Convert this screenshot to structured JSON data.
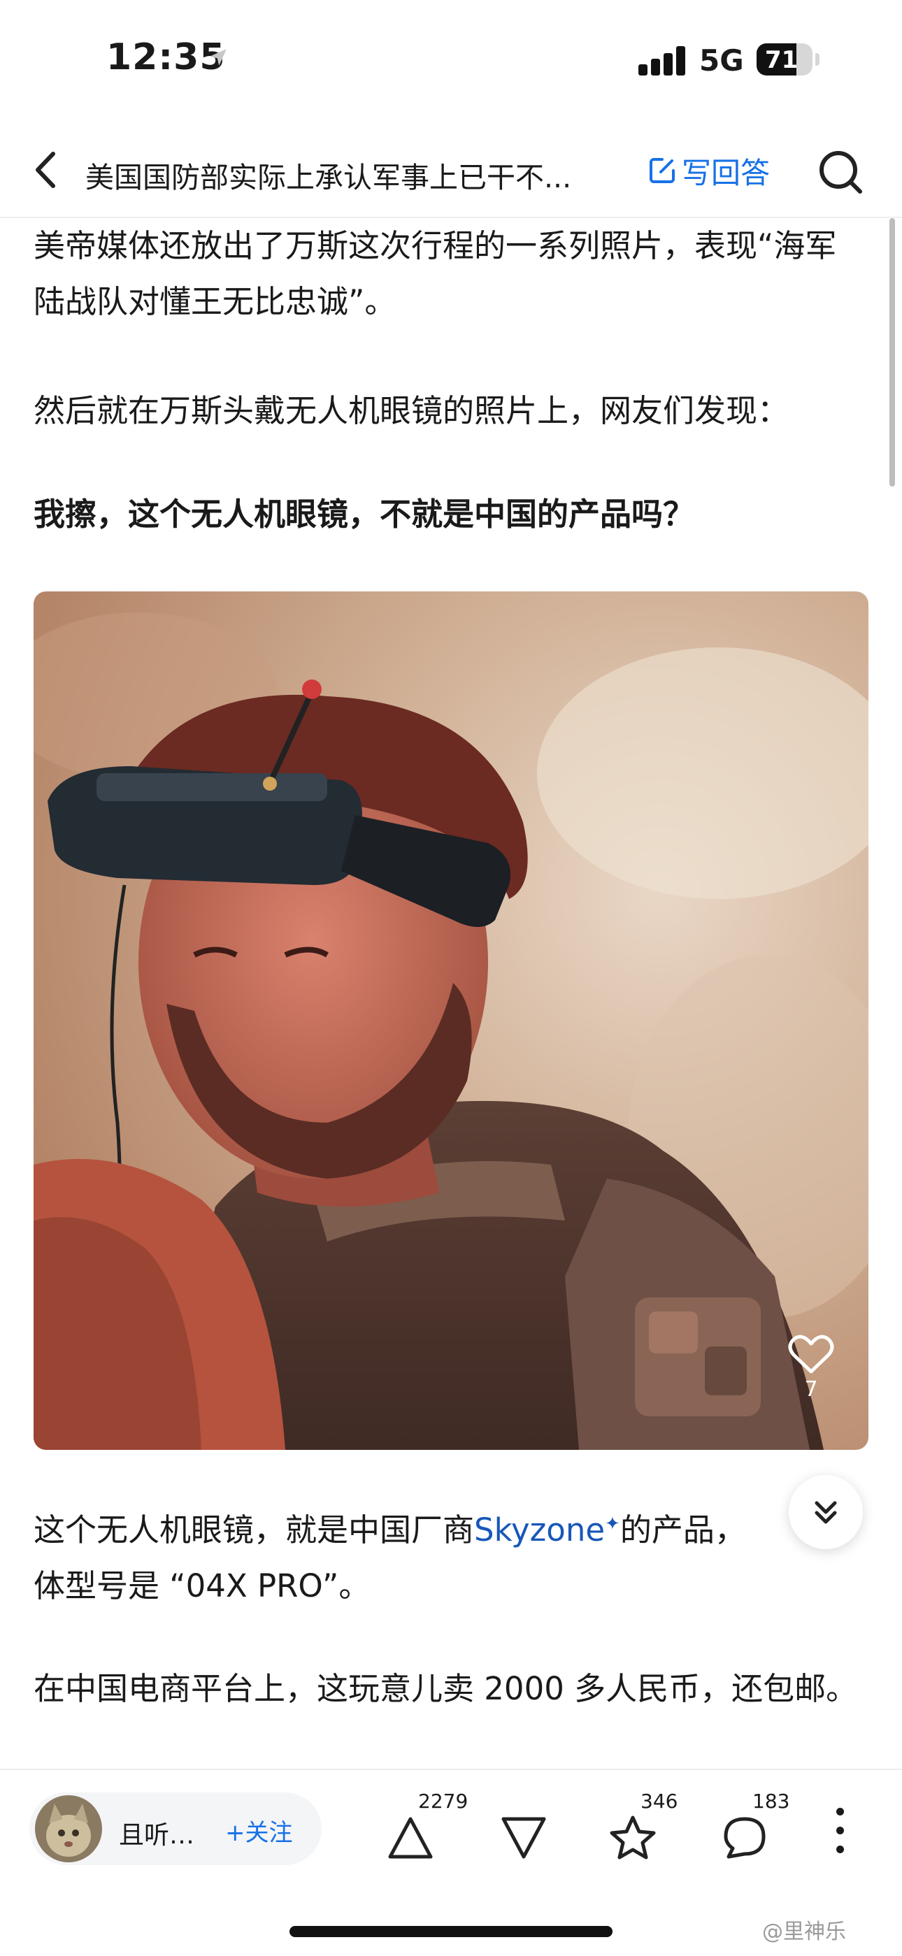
{
  "status_bar": {
    "time": "12:35",
    "network": "5G",
    "battery": "71",
    "battery_level": 0.71
  },
  "nav": {
    "title": "美国国防部实际上承认军事上已干不...",
    "write_answer": "写回答",
    "icons": {
      "back": "chevron-left-icon",
      "write": "edit-icon",
      "search": "search-icon"
    }
  },
  "article": {
    "paragraphs": [
      "美帝媒体还放出了万斯这次行程的一系列照片，表现“海军陆战队对懂王无比忠诚”。",
      "然后就在万斯头戴无人机眼镜的照片上，网友们发现：",
      "我擦，这个无人机眼镜，不就是中国的产品吗？"
    ],
    "after_image": {
      "prefix": "这个无人机眼镜，就是中国厂商",
      "link": "Skyzone",
      "link_mark": "✦",
      "suffix": "的产品，",
      "line2": "体型号是 “04X PRO”。"
    },
    "last_paragraph": "在中国电商平台上，这玩意儿卖 2000 多人民币，还包邮。",
    "image_like_count": "7"
  },
  "bottom_bar": {
    "author_name": "且听…",
    "follow_label": "+关注",
    "upvote_count": "2279",
    "favorite_count": "346",
    "comment_count": "183",
    "icons": {
      "upvote": "upvote-triangle-icon",
      "downvote": "downvote-triangle-icon",
      "favorite": "star-icon",
      "comment": "comment-bubble-icon",
      "more": "more-vertical-icon"
    }
  },
  "watermark": "@里神乐"
}
